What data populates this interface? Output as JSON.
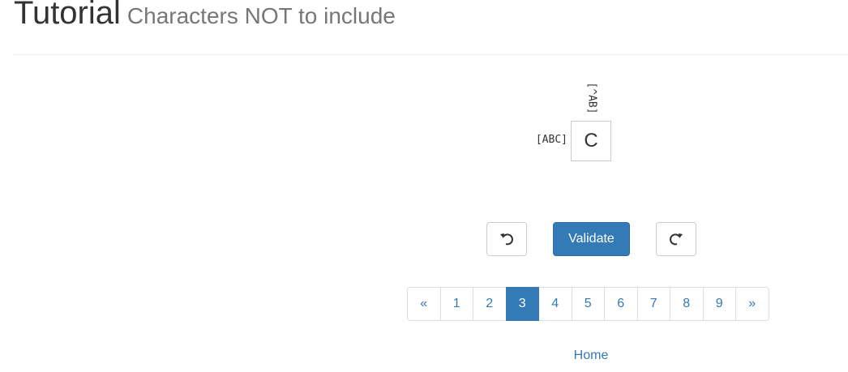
{
  "header": {
    "title": "Tutorial",
    "subtitle": "Characters NOT to include"
  },
  "puzzle": {
    "column_clue": "[^AB]",
    "row_clue": "[ABC]",
    "cell_value": "C"
  },
  "controls": {
    "undo_icon": "undo-arrow",
    "validate_label": "Validate",
    "redo_icon": "redo-arrow"
  },
  "pagination": {
    "prev_label": "«",
    "pages": [
      "1",
      "2",
      "3",
      "4",
      "5",
      "6",
      "7",
      "8",
      "9"
    ],
    "active_page": "3",
    "next_label": "»"
  },
  "footer": {
    "home_label": "Home"
  },
  "colors": {
    "primary": "#337ab7",
    "border": "#cccccc",
    "muted_text": "#777777"
  }
}
